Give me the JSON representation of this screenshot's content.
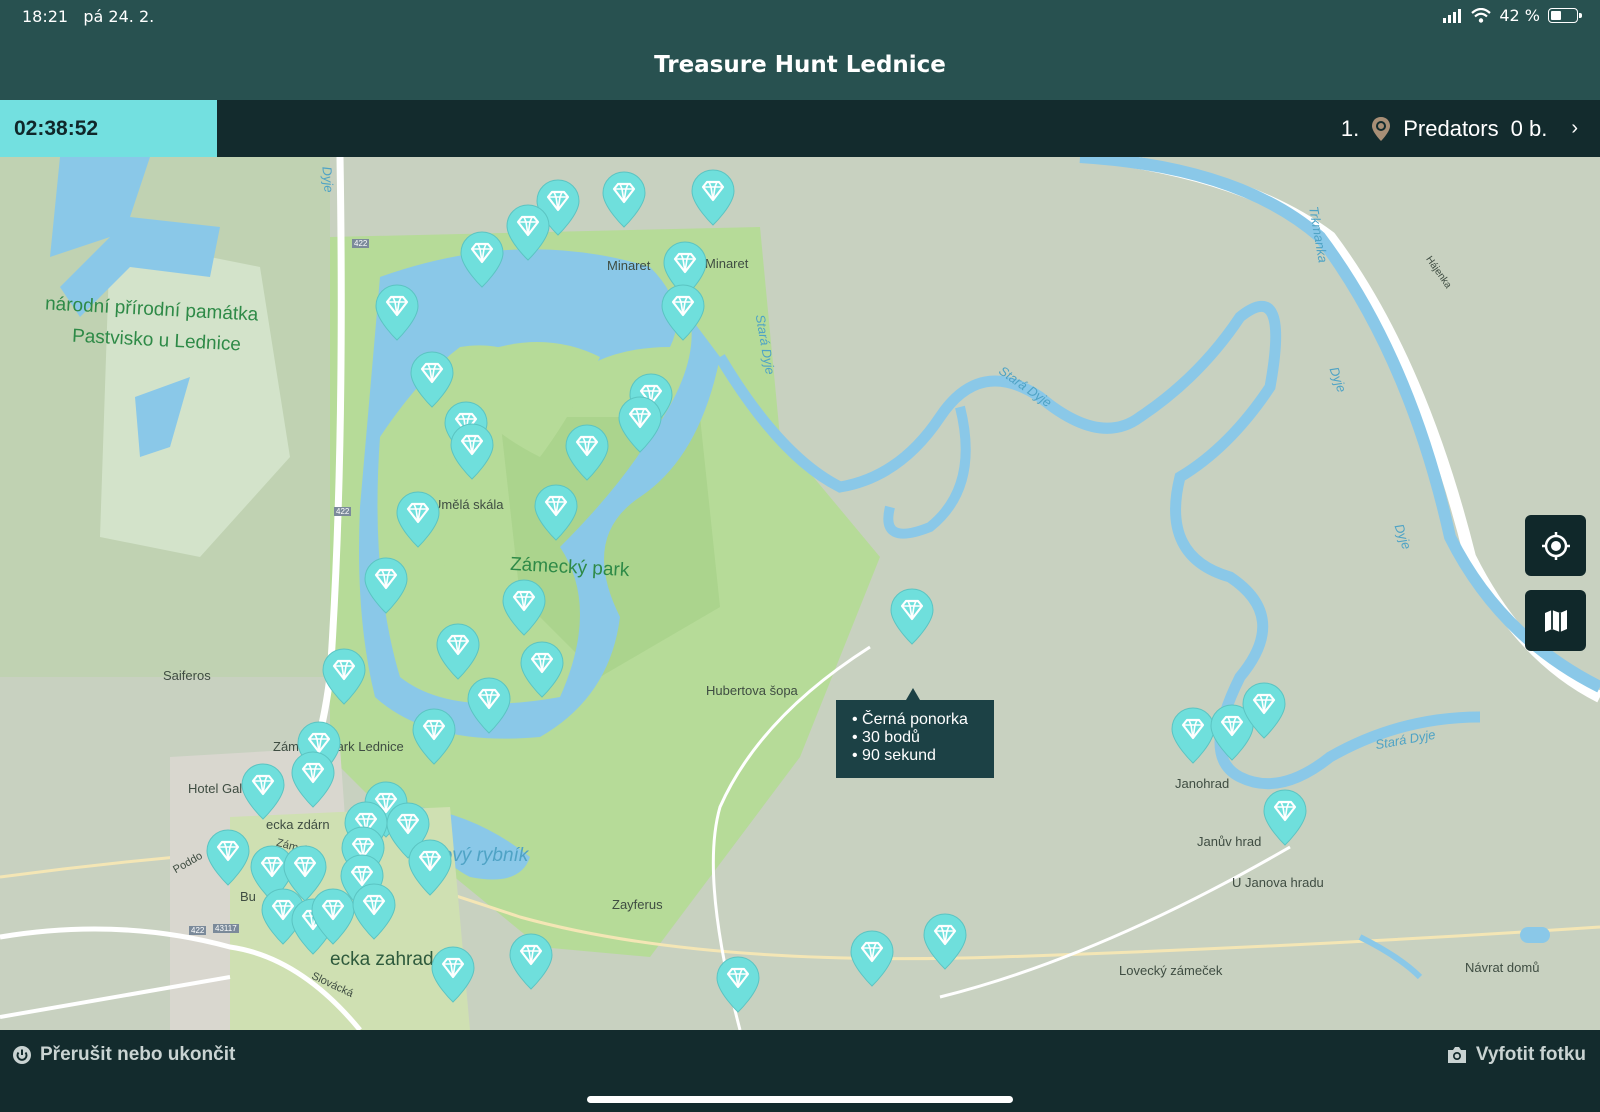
{
  "status_bar": {
    "time": "18:21",
    "date": "pá 24. 2.",
    "battery": "42 %",
    "battery_fraction": 0.42
  },
  "header": {
    "title": "Treasure Hunt Lednice"
  },
  "info_bar": {
    "timer": "02:38:52",
    "rank": "1.",
    "team": "Predators",
    "score": "0 b."
  },
  "map": {
    "labels": {
      "reserve_line1": "národní přírodní památka",
      "reserve_line2": "Pastvisko u Lednice",
      "minaret_1": "Minaret",
      "minaret_2": "Minaret",
      "stara_dyje_1": "Stará Dyje",
      "stara_dyje_2": "Stará Dyje",
      "stara_dyje_3": "Stará Dyje",
      "dyje_1": "Dyje",
      "dyje_2": "Dyje",
      "dyje_3": "Dyje",
      "trkmanka": "Trkmanka",
      "hajenka": "Hájenka",
      "umela_skala": "Umělá skála",
      "zamecky_park": "Zámecký park",
      "saiferos": "Saiferos",
      "hubertova_sopa": "Hubertova šopa",
      "zamecky_park_lednice": "Zámecký park Lednice",
      "hotel": "Hotel Gal",
      "zahrada_1": "ecka zdárn",
      "zamek": "Zámek",
      "krizovy_rybnik": "ižový rybník",
      "poddo": "Poddo",
      "bu": "Bu",
      "zahrada": "ecka zahrada",
      "slovacka": "Slovácká",
      "zayferus": "Zayferus",
      "janohrad": "Janohrad",
      "januv_hrad": "Janův hrad",
      "u_janova_hradu": "U Janova hradu",
      "lovecky_zamecek": "Lovecký zámeček",
      "navrat_domu": "Návrat domů",
      "road_422_a": "422",
      "road_422_b": "422",
      "road_422_c": "422",
      "road_43117": "43117"
    },
    "popup": {
      "items": [
        "Černá ponorka",
        "30 bodů",
        "90 sekund"
      ]
    },
    "buttons": {
      "locate_icon": "crosshair-icon",
      "map_icon": "map-icon"
    }
  },
  "bottom_bar": {
    "stop_label": "Přerušit nebo ukončit",
    "photo_label": "Vyfotit fotku"
  },
  "colors": {
    "header": "#285150",
    "bar": "#132b2d",
    "accent": "#73e0e0",
    "pin": "#6fdfdc",
    "water": "#8ac8e8",
    "park": "#b9dc9b"
  }
}
